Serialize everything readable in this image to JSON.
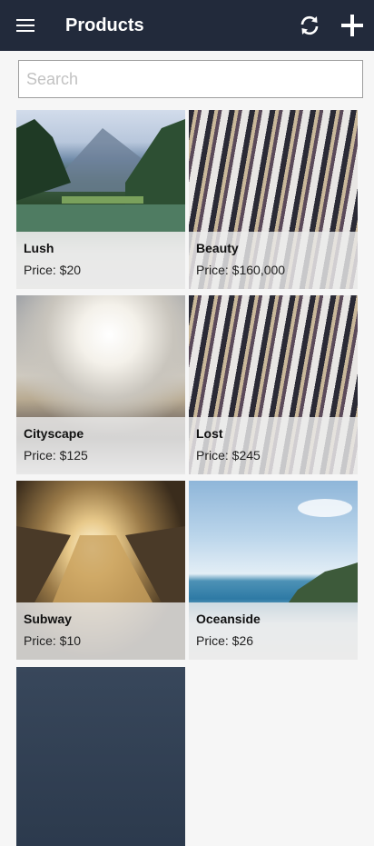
{
  "appbar": {
    "title": "Products",
    "menu_icon": "hamburger-menu-icon",
    "refresh_icon": "refresh-icon",
    "add_icon": "plus-icon",
    "background": "#222a3b"
  },
  "search": {
    "placeholder": "Search",
    "value": ""
  },
  "products": [
    {
      "name": "Lush",
      "price": "Price: $20"
    },
    {
      "name": "Beauty",
      "price": "Price: $160,000"
    },
    {
      "name": "Cityscape",
      "price": "Price: $125"
    },
    {
      "name": "Lost",
      "price": "Price: $245"
    },
    {
      "name": "Subway",
      "price": "Price: $10"
    },
    {
      "name": "Oceanside",
      "price": "Price: $26"
    }
  ]
}
